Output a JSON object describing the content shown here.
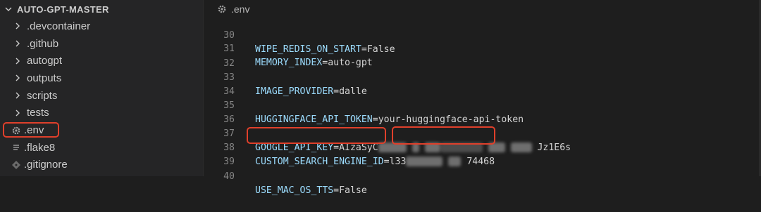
{
  "explorer": {
    "title": "AUTO-GPT-MASTER",
    "items": [
      {
        "label": ".devcontainer",
        "kind": "folder"
      },
      {
        "label": ".github",
        "kind": "folder"
      },
      {
        "label": "autogpt",
        "kind": "folder"
      },
      {
        "label": "outputs",
        "kind": "folder"
      },
      {
        "label": "scripts",
        "kind": "folder"
      },
      {
        "label": "tests",
        "kind": "folder"
      },
      {
        "label": ".env",
        "kind": "file",
        "icon": "gear-icon",
        "highlighted": true
      },
      {
        "label": ".flake8",
        "kind": "file",
        "icon": "lines-icon"
      },
      {
        "label": ".gitignore",
        "kind": "file",
        "icon": "git-diamond-icon"
      }
    ]
  },
  "editor": {
    "tab_title": ".env",
    "lines": [
      {
        "num": "30",
        "key": "WIPE_REDIS_ON_START",
        "eq": "=",
        "value": "False"
      },
      {
        "num": "31",
        "key": "MEMORY_INDEX",
        "eq": "=",
        "value": "auto-gpt"
      },
      {
        "num": "32",
        "key": "",
        "eq": "",
        "value": ""
      },
      {
        "num": "33",
        "key": "IMAGE_PROVIDER",
        "eq": "=",
        "value": "dalle"
      },
      {
        "num": "34",
        "key": "",
        "eq": "",
        "value": ""
      },
      {
        "num": "35",
        "key": "HUGGINGFACE_API_TOKEN",
        "eq": "=",
        "value": "your-huggingface-api-token"
      },
      {
        "num": "36",
        "key": "",
        "eq": "",
        "value": ""
      },
      {
        "num": "37",
        "key": "GOOGLE_API_KEY",
        "eq": "=",
        "value_start": "AIzaSyC",
        "value_end": "Jz1E6s"
      },
      {
        "num": "38",
        "key": "CUSTOM_SEARCH_ENGINE_ID",
        "eq": "=",
        "value_start": "l33",
        "value_end": "74468"
      },
      {
        "num": "39",
        "key": "",
        "eq": "",
        "value": ""
      },
      {
        "num": "40",
        "key": "USE_MAC_OS_TTS",
        "eq": "=",
        "value": "False"
      }
    ]
  },
  "colors": {
    "sidebar_bg": "#252526",
    "editor_bg": "#1e1e1e",
    "key_color": "#9cdcfe",
    "line_number": "#858585",
    "highlight_red": "#e0402b"
  }
}
